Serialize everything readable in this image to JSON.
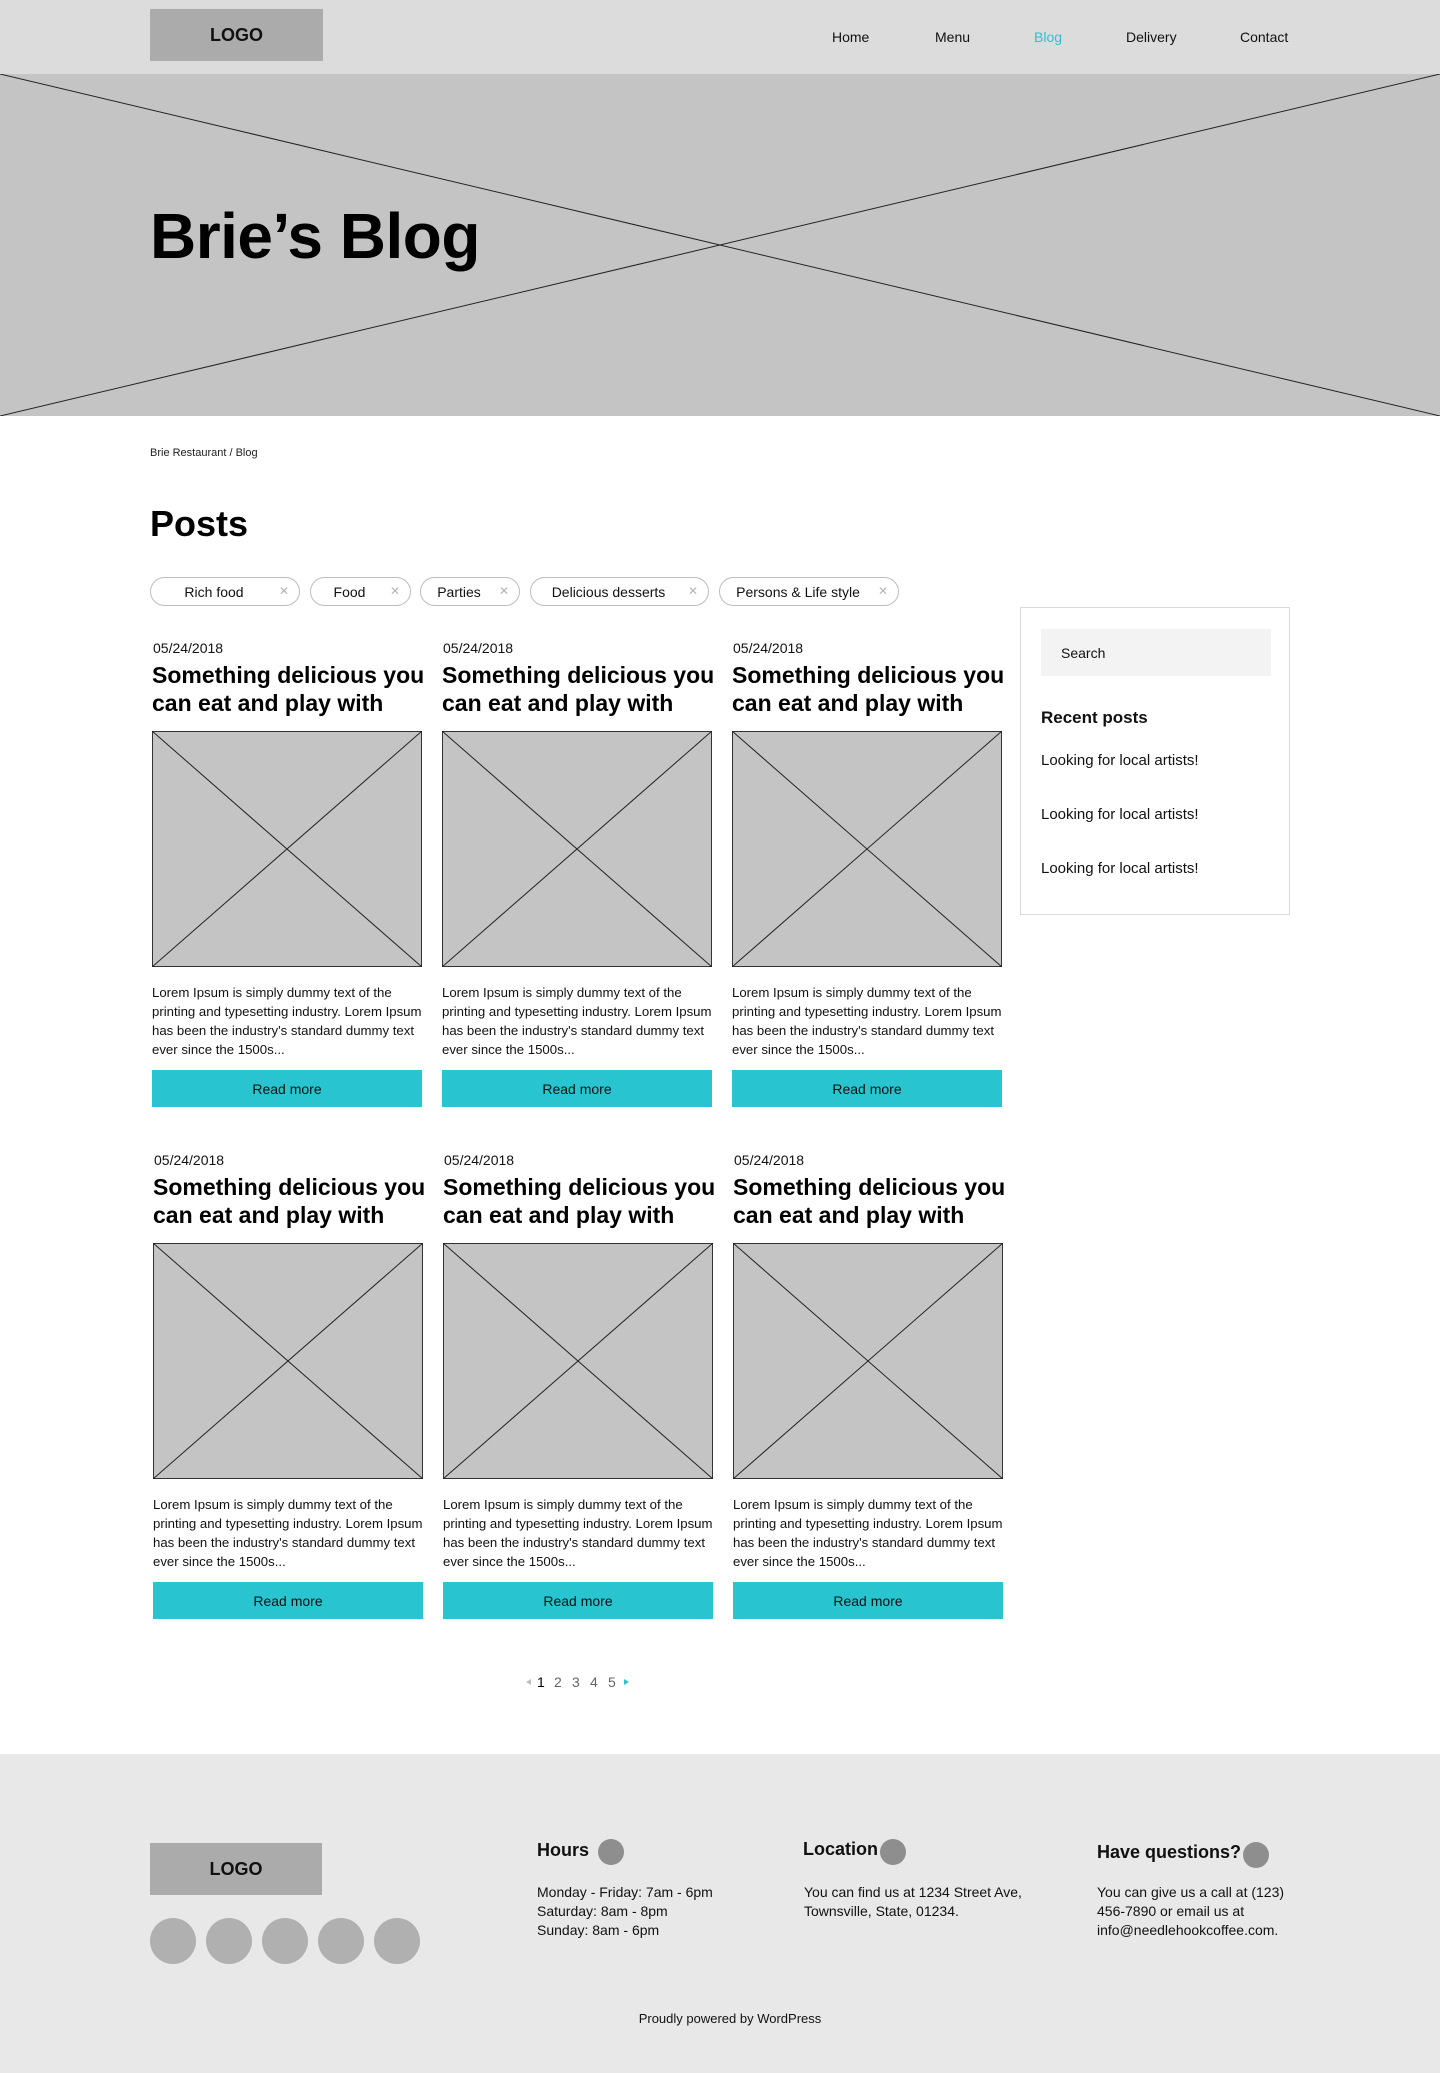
{
  "header": {
    "logo": "LOGO",
    "nav": [
      "Home",
      "Menu",
      "Blog",
      "Delivery",
      "Contact"
    ],
    "active_nav": "Blog",
    "accent_color": "#2cc3cf"
  },
  "hero": {
    "title": "Brie’s Blog"
  },
  "breadcrumb": "Brie Restaurant / Blog",
  "posts_heading": "Posts",
  "filters": [
    {
      "label": "Rich food",
      "remove_icon": "close-icon"
    },
    {
      "label": "Food",
      "remove_icon": "close-icon"
    },
    {
      "label": "Parties",
      "remove_icon": "close-icon"
    },
    {
      "label": "Delicious desserts",
      "remove_icon": "close-icon"
    },
    {
      "label": "Persons & Life style",
      "remove_icon": "close-icon"
    }
  ],
  "sidebar": {
    "search_placeholder": "Search",
    "recent_title": "Recent posts",
    "recent_posts": [
      "Looking for local artists!",
      "Looking for local artists!",
      "Looking for local artists!"
    ]
  },
  "posts": [
    {
      "date": "05/24/2018",
      "title": "Something delicious you can eat and play with",
      "excerpt": "Lorem Ipsum is simply dummy text of the printing and typesetting industry. Lorem Ipsum has been the industry's standard dummy text ever since the 1500s...",
      "button": "Read more"
    },
    {
      "date": "05/24/2018",
      "title": "Something delicious you can eat and play with",
      "excerpt": "Lorem Ipsum is simply dummy text of the printing and typesetting industry. Lorem Ipsum has been the industry's standard dummy text ever since the 1500s...",
      "button": "Read more"
    },
    {
      "date": "05/24/2018",
      "title": "Something delicious you can eat and play with",
      "excerpt": "Lorem Ipsum is simply dummy text of the printing and typesetting industry. Lorem Ipsum has been the industry's standard dummy text ever since the 1500s...",
      "button": "Read more"
    },
    {
      "date": "05/24/2018",
      "title": "Something delicious you can eat and play with",
      "excerpt": "Lorem Ipsum is simply dummy text of the printing and typesetting industry. Lorem Ipsum has been the industry's standard dummy text ever since the 1500s...",
      "button": "Read more"
    },
    {
      "date": "05/24/2018",
      "title": "Something delicious you can eat and play with",
      "excerpt": "Lorem Ipsum is simply dummy text of the printing and typesetting industry. Lorem Ipsum has been the industry's standard dummy text ever since the 1500s...",
      "button": "Read more"
    },
    {
      "date": "05/24/2018",
      "title": "Something delicious you can eat and play with",
      "excerpt": "Lorem Ipsum is simply dummy text of the printing and typesetting industry. Lorem Ipsum has been the industry's standard dummy text ever since the 1500s...",
      "button": "Read more"
    }
  ],
  "pagination": {
    "pages": [
      "1",
      "2",
      "3",
      "4",
      "5"
    ],
    "current": "1",
    "prev_icon": "arrow-left-icon",
    "next_icon": "arrow-right-icon"
  },
  "footer": {
    "logo": "LOGO",
    "social_count": 5,
    "hours_title": "Hours",
    "hours_lines": [
      "Monday - Friday: 7am - 6pm",
      "Saturday: 8am - 8pm",
      "Sunday: 8am - 6pm"
    ],
    "location_title": "Location",
    "location_lines": [
      "You can find us at 1234 Street Ave,",
      "Townsville, State, 01234."
    ],
    "questions_title": "Have questions?",
    "questions_lines": [
      "You can give us a call at (123)",
      "456-7890 or email us at",
      "info@needlehookcoffee.com."
    ],
    "credit": "Proudly powered by WordPress"
  },
  "colors": {
    "button": "#28c4cf",
    "placeholder_image": "#c4c4c4",
    "header_bg": "#dcdcdc",
    "footer_bg": "#e8e8e8"
  }
}
